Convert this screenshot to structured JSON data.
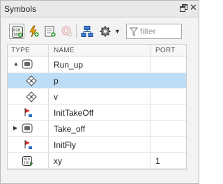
{
  "panel": {
    "title": "Symbols",
    "undock_icon": "undock-icon",
    "close_icon": "close-icon"
  },
  "toolbar": {
    "buttons": [
      {
        "name": "resolve-undefined-symbols-button",
        "icon": "resolve-symbols-icon"
      },
      {
        "name": "add-event-button",
        "icon": "add-event-icon"
      },
      {
        "name": "add-data-button",
        "icon": "add-data-icon"
      },
      {
        "name": "add-message-button",
        "icon": "add-message-icon",
        "disabled": true
      },
      {
        "name": "hierarchy-view-button",
        "icon": "hierarchy-icon"
      },
      {
        "name": "settings-dropdown-button",
        "icon": "gear-icon"
      }
    ],
    "filter_placeholder": "filter",
    "filter_value": ""
  },
  "table": {
    "columns": [
      "TYPE",
      "NAME",
      "PORT"
    ],
    "rows": [
      {
        "expander": "▲",
        "type_icon": "state-icon",
        "name": "Run_up",
        "port": "",
        "selected": false
      },
      {
        "expander": "",
        "type_icon": "local-data-icon",
        "name": "p",
        "port": "",
        "selected": true
      },
      {
        "expander": "",
        "type_icon": "local-data-icon",
        "name": "v",
        "port": "",
        "selected": false
      },
      {
        "expander": "",
        "type_icon": "event-flag-icon",
        "name": "InitTakeOff",
        "port": "",
        "selected": false
      },
      {
        "expander": "▶",
        "type_icon": "state-icon",
        "name": "Take_off",
        "port": "",
        "selected": false
      },
      {
        "expander": "",
        "type_icon": "event-flag-icon",
        "name": "InitFly",
        "port": "",
        "selected": false
      },
      {
        "expander": "",
        "type_icon": "input-data-icon",
        "name": "xy",
        "port": "1",
        "selected": false
      }
    ]
  },
  "colors": {
    "selection": "#bddcf5",
    "event_red": "#d12a2a",
    "event_blue": "#2b6cc4",
    "lightning": "#e8a400"
  }
}
